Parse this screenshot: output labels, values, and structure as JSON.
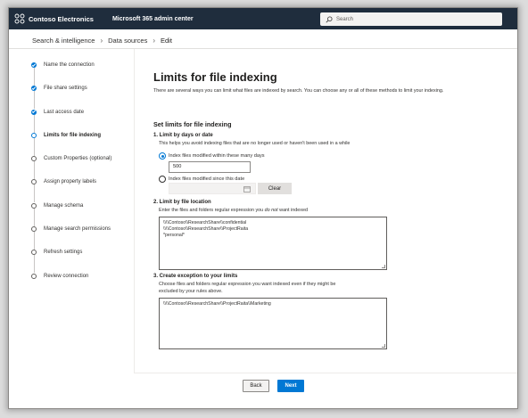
{
  "header": {
    "brand": "Contoso Electronics",
    "product": "Microsoft 365 admin center",
    "search_placeholder": "Search",
    "bar_color": "#1f2d3d"
  },
  "breadcrumb": {
    "items": [
      "Search & intelligence",
      "Data sources",
      "Edit"
    ]
  },
  "steps": [
    {
      "label": "Name the connection",
      "state": "done"
    },
    {
      "label": "File share settings",
      "state": "done"
    },
    {
      "label": "Last access date",
      "state": "done"
    },
    {
      "label": "Limits for file indexing",
      "state": "current"
    },
    {
      "label": "Custom Properties (optional)",
      "state": "todo"
    },
    {
      "label": "Assign property labels",
      "state": "todo"
    },
    {
      "label": "Manage schema",
      "state": "todo"
    },
    {
      "label": "Manage search permissions",
      "state": "todo"
    },
    {
      "label": "Refresh settings",
      "state": "todo"
    },
    {
      "label": "Review connection",
      "state": "todo"
    }
  ],
  "main": {
    "title": "Limits for file indexing",
    "description": "There are several ways you can limit what files are indexed by search. You can choose any or all of these methods to limit your indexing.",
    "section_title": "Set limits for file indexing",
    "days_section": {
      "title": "1. Limit by days or date",
      "hint": "This helps you avoid indexing files that are no longer used or haven't been used in a while",
      "option_days_label": "Index files modified within these many days",
      "days_value": "500",
      "option_date_label": "Index files modified since this date",
      "clear_label": "Clear"
    },
    "location_section": {
      "title": "2. Limit by file location",
      "hint_before": "Enter the files and folders regular expression you ",
      "hint_em": "do not",
      "hint_after": " want indexed",
      "lines": [
        "\\\\\\\\Contoso\\\\ResearchShare\\\\confidential",
        "\\\\\\\\Contoso\\\\ResearchShare\\\\ProjectRaita",
        "*personal*"
      ]
    },
    "exception_section": {
      "title": "3. Create exception to your limits",
      "hint_line1": "Choose files and folders regular expression you want indexed even if they might be",
      "hint_line2": "excluded by your rules above.",
      "lines": [
        "\\\\\\\\Contoso\\\\ResearchShare\\\\ProjectRaita\\\\Marketing"
      ]
    }
  },
  "footer": {
    "back_label": "Back",
    "next_label": "Next",
    "accent": "#0078d4"
  }
}
